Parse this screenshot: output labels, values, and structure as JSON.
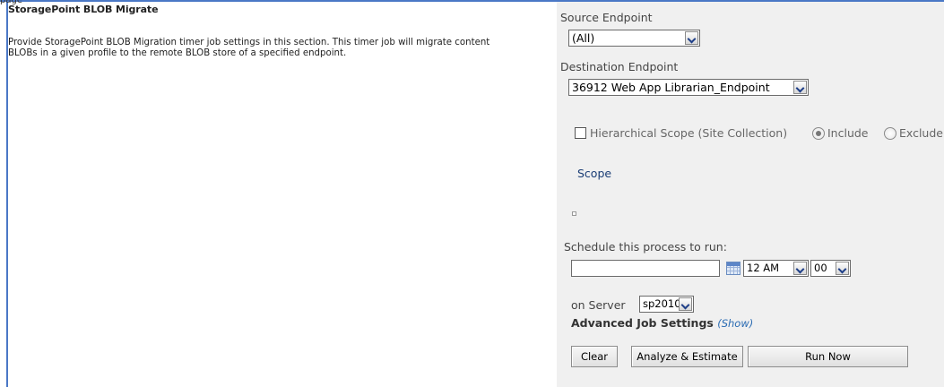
{
  "page_tag": "page",
  "section": {
    "title": "StoragePoint BLOB Migrate",
    "description": "Provide StoragePoint BLOB Migration timer job settings in this section. This timer job will migrate content BLOBs in a given profile to the remote BLOB store of a specified endpoint."
  },
  "form": {
    "source_endpoint_label": "Source Endpoint",
    "source_endpoint_value": "(All)",
    "destination_endpoint_label": "Destination Endpoint",
    "destination_endpoint_value": "36912 Web App Librarian_Endpoint",
    "hierarchical_scope_label": "Hierarchical Scope (Site Collection)",
    "include_label": "Include",
    "exclude_label": "Exclude",
    "scope_label": "Scope",
    "schedule_label": "Schedule this process to run:",
    "schedule_date_value": "",
    "hour_value": "12 AM",
    "minute_value": "00",
    "server_label": "on Server",
    "server_value": "sp2010",
    "advanced_label": "Advanced Job Settings",
    "show_link": "(Show)"
  },
  "buttons": {
    "clear": "Clear",
    "analyze": "Analyze & Estimate",
    "run_now": "Run Now"
  },
  "colors": {
    "accent_border": "#4a78c6",
    "panel_bg": "#f0f0f0",
    "link": "#2b6cb3"
  }
}
